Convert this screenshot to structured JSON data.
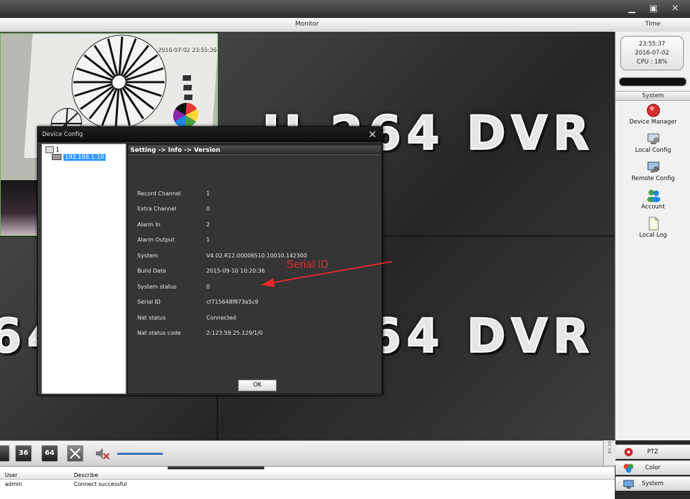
{
  "header": {
    "monitor_title": "Monitor",
    "time_title": "Time"
  },
  "camera": {
    "timestamp": "2016-07-02 23:55:36"
  },
  "watermark": {
    "text_top": "H.264 DVR",
    "text_bottom": "H.264 DVR"
  },
  "clock": {
    "time": "23:55:37",
    "date": "2016-07-02",
    "cpu": "CPU : 18%"
  },
  "system_panel": {
    "header": "System",
    "items": [
      {
        "label": "Device Manager",
        "icon": "device-manager-icon"
      },
      {
        "label": "Local Config",
        "icon": "local-config-icon"
      },
      {
        "label": "Remote Config",
        "icon": "remote-config-icon"
      },
      {
        "label": "Account",
        "icon": "account-icon"
      },
      {
        "label": "Local Log",
        "icon": "local-log-icon"
      }
    ]
  },
  "dialog": {
    "title": "Device Config",
    "close": "✕",
    "tree": {
      "root": "1",
      "node": "192.168.1.10"
    },
    "breadcrumb": "Setting -> Info -> Version",
    "rows": [
      {
        "key": "Record Channel",
        "value": "1"
      },
      {
        "key": "Extra Channel",
        "value": "0"
      },
      {
        "key": "Alarm In",
        "value": "2"
      },
      {
        "key": "Alarm Output",
        "value": "1"
      },
      {
        "key": "System",
        "value": "V4.02.R12.00006510.10010.142300"
      },
      {
        "key": "Build Date",
        "value": "2015-09-10 10:20:36"
      },
      {
        "key": "System status",
        "value": "0"
      },
      {
        "key": "Serial ID",
        "value": "cf715648f873a5c9"
      },
      {
        "key": "Nat status",
        "value": "Connected"
      },
      {
        "key": "Nat status code",
        "value": "2:123.59.25.129/1/0"
      }
    ],
    "ok_label": "OK"
  },
  "annotation": {
    "label": "Serial ID",
    "color": "#e02a2a"
  },
  "toolbar": {
    "btn_36": "36",
    "btn_64": "64"
  },
  "log": {
    "columns": [
      "User",
      "Describe"
    ],
    "rows": [
      {
        "user": "admin",
        "describe": "Connect successful"
      }
    ]
  },
  "bottom_buttons": [
    {
      "label": "PTZ",
      "icon": "ptz-icon"
    },
    {
      "label": "Color",
      "icon": "color-icon"
    },
    {
      "label": "System",
      "icon": "system-icon"
    }
  ]
}
